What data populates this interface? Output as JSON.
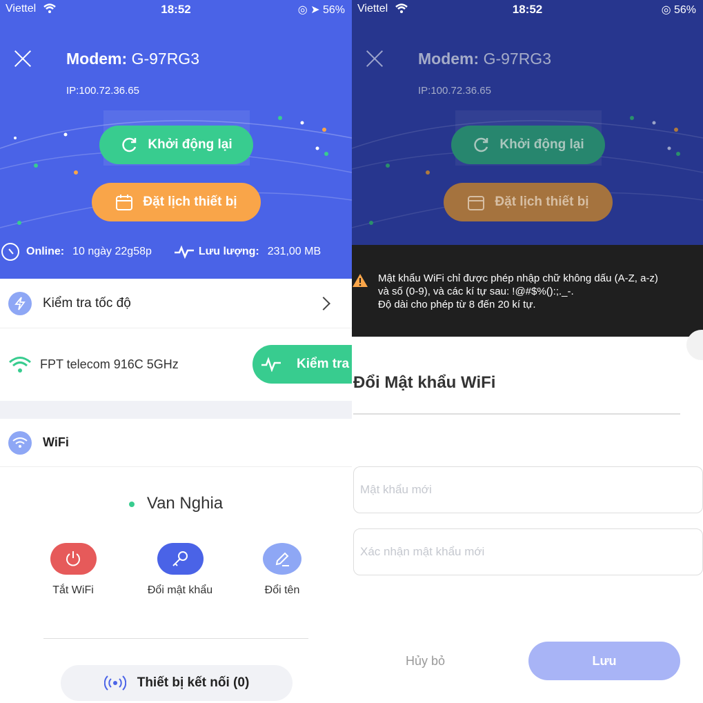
{
  "status": {
    "carrier": "Viettel",
    "time": "18:52",
    "battery": "56%"
  },
  "header": {
    "modem_label": "Modem:",
    "modem_name": "G-97RG3",
    "ip": "IP:100.72.36.65"
  },
  "buttons": {
    "restart": "Khởi động lại",
    "schedule": "Đặt lịch thiết bị"
  },
  "stats": {
    "online_label": "Online:",
    "online_value": "10 ngày 22g58p",
    "traffic_label": "Lưu lượng:",
    "traffic_value": "231,00 MB"
  },
  "speed_test": {
    "title": "Kiểm tra tốc độ",
    "network": "FPT telecom 916C 5GHz",
    "test_button": "Kiểm tra"
  },
  "wifi": {
    "section_title": "WiFi",
    "ssid": "Van Nghia",
    "actions": [
      {
        "label": "Tắt WiFi",
        "icon": "power-icon",
        "color": "#e65a5a"
      },
      {
        "label": "Đổi mật khẩu",
        "icon": "key-icon",
        "color": "#4a63e7"
      },
      {
        "label": "Đổi tên",
        "icon": "edit-icon",
        "color": "#8ea7f5"
      }
    ],
    "devices_label": "Thiết bị kết nối (0)"
  },
  "warning": {
    "line1": "Mật khẩu WiFi chỉ được phép nhập chữ không dấu (A-Z, a-z)",
    "line2": "và số (0-9), và các kí tự sau: !@#$%():;._-.",
    "line3": "Độ dài cho phép từ 8 đến 20 kí tự."
  },
  "change_password": {
    "title": "Đổi Mật khẩu WiFi",
    "new_password_placeholder": "Mật khẩu mới",
    "confirm_placeholder": "Xác nhận mật khẩu mới",
    "cancel": "Hủy bỏ",
    "save": "Lưu"
  },
  "colors": {
    "primary": "#4a63e7",
    "green": "#38cc8f",
    "orange": "#f9a549",
    "red": "#e65a5a"
  }
}
